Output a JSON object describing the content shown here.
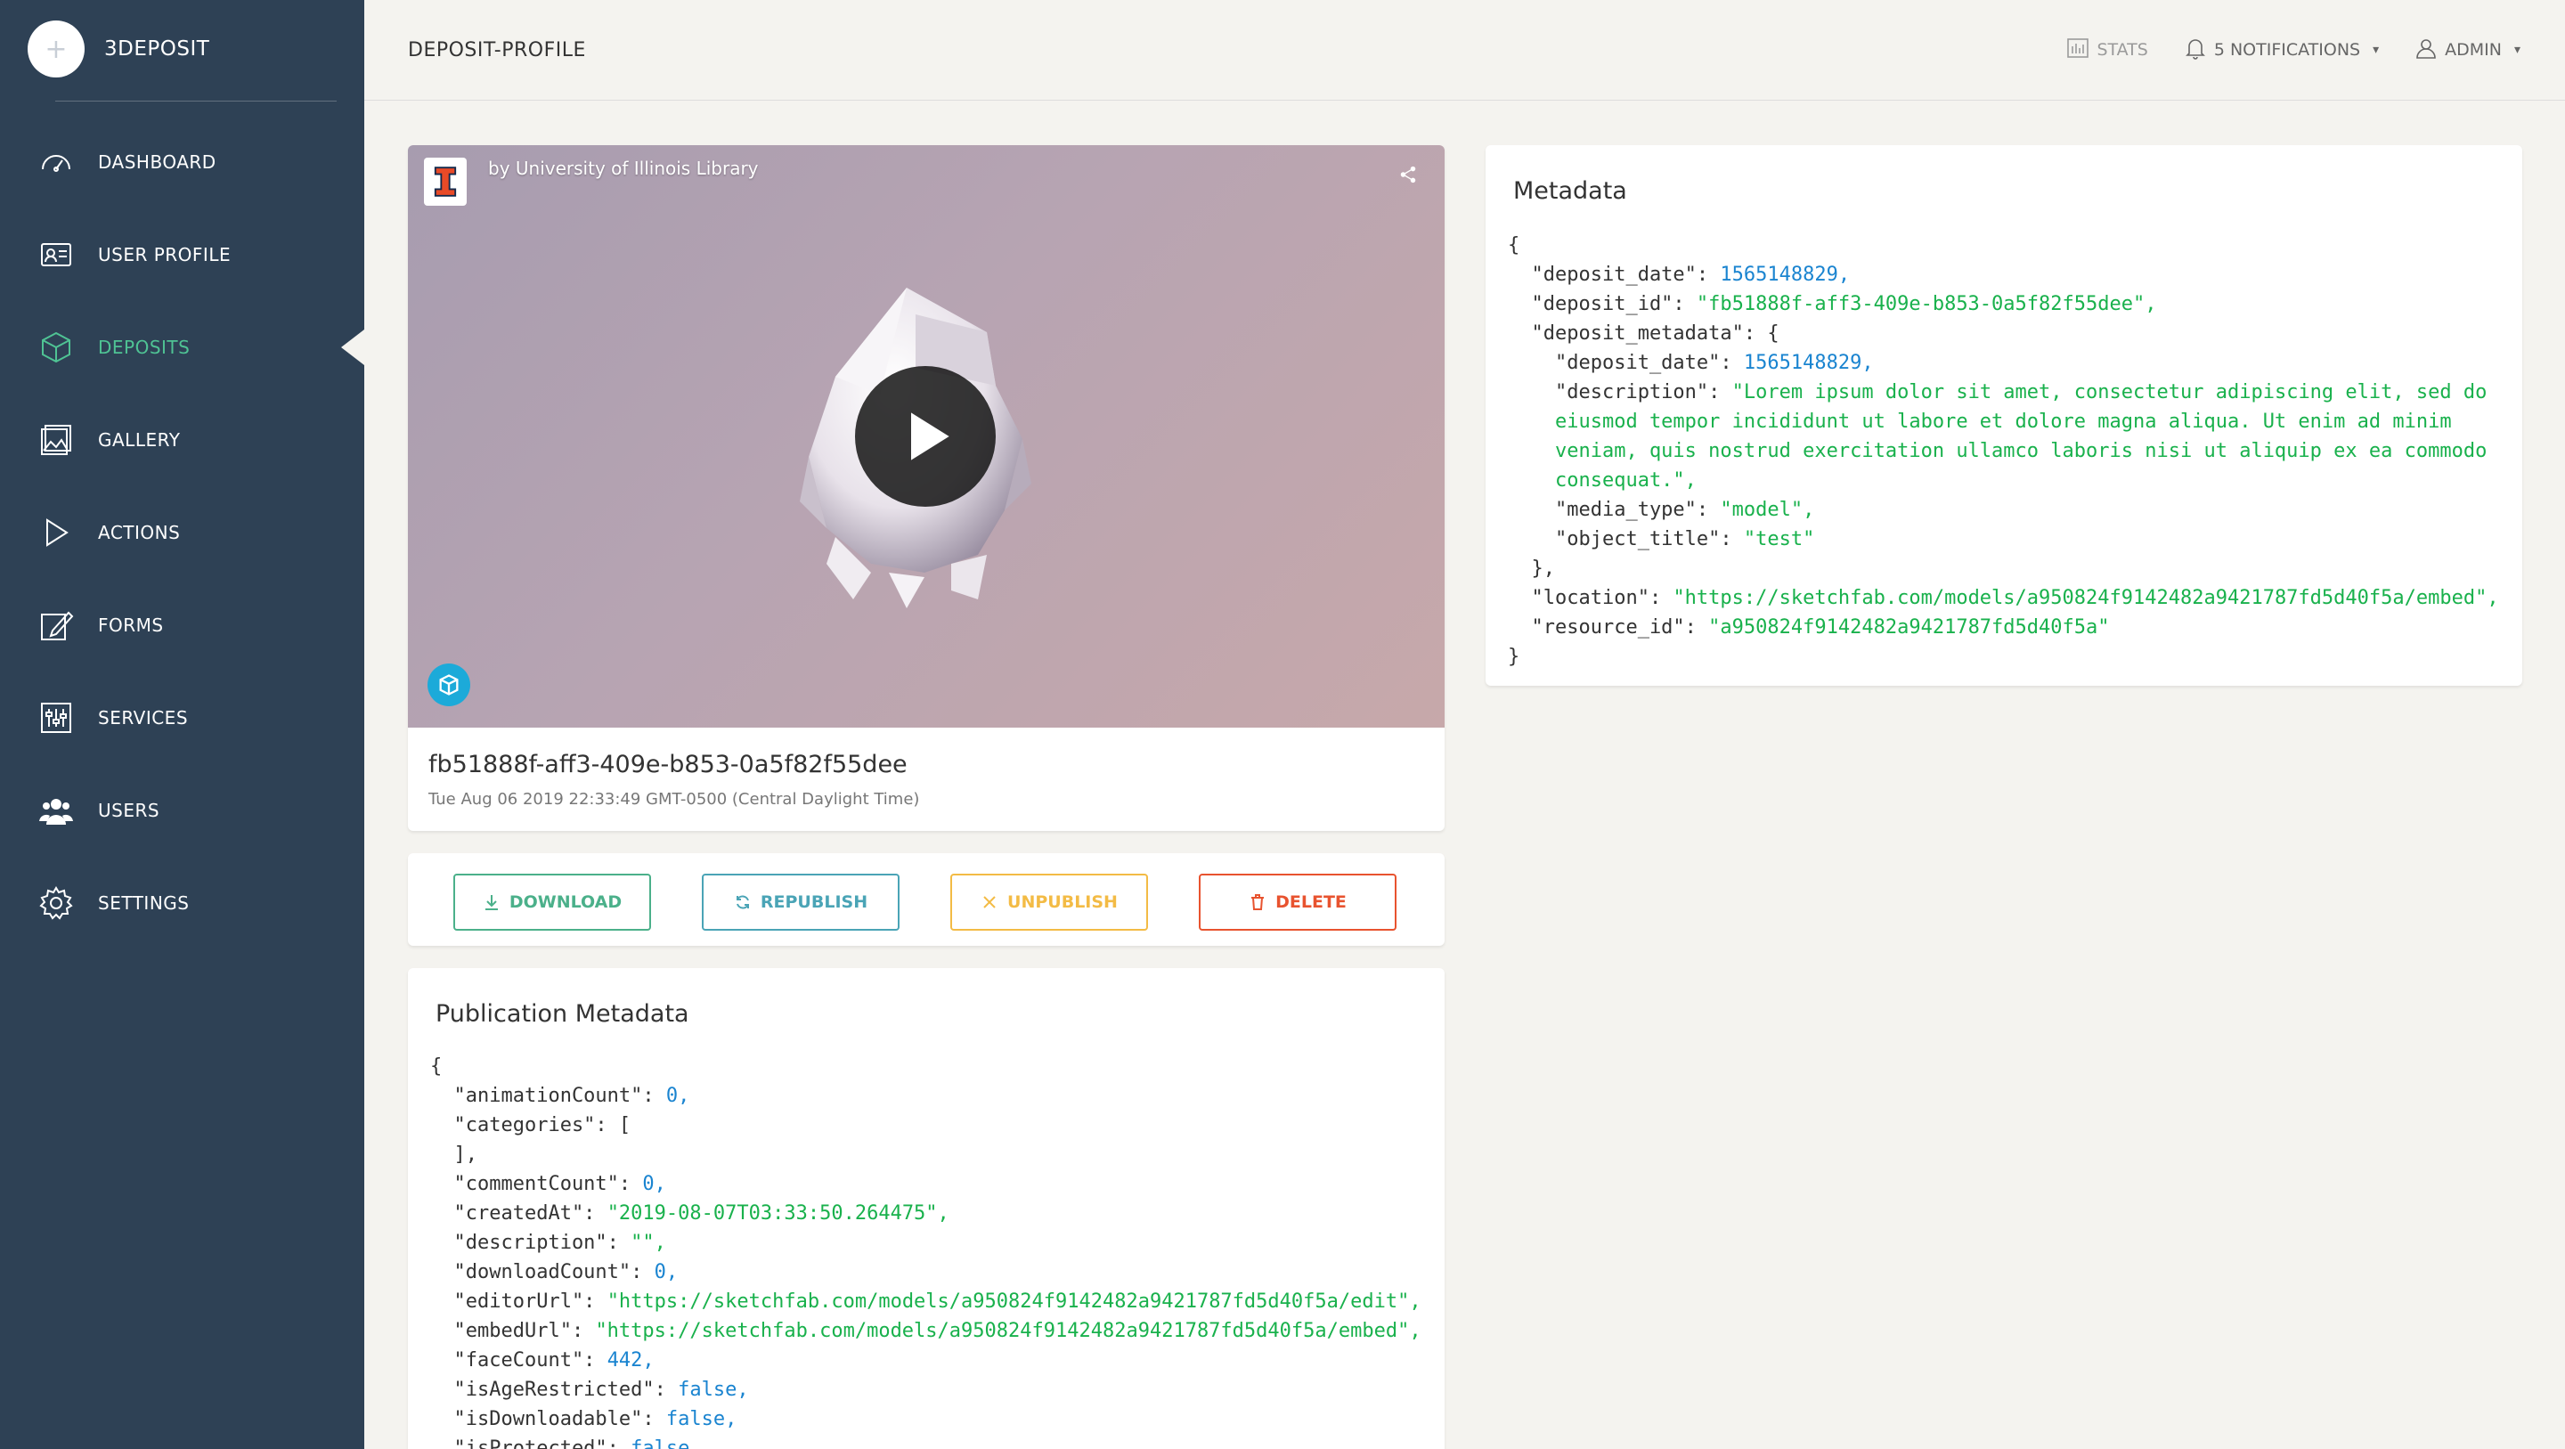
{
  "brand": {
    "name": "3DEPOSIT"
  },
  "sidebar": {
    "items": [
      {
        "label": "DASHBOARD",
        "icon": "dashboard-icon"
      },
      {
        "label": "USER PROFILE",
        "icon": "user-profile-icon"
      },
      {
        "label": "DEPOSITS",
        "icon": "cube-icon",
        "active": true
      },
      {
        "label": "GALLERY",
        "icon": "gallery-icon"
      },
      {
        "label": "ACTIONS",
        "icon": "play-icon"
      },
      {
        "label": "FORMS",
        "icon": "edit-icon"
      },
      {
        "label": "SERVICES",
        "icon": "sliders-icon"
      },
      {
        "label": "USERS",
        "icon": "users-icon"
      },
      {
        "label": "SETTINGS",
        "icon": "gear-icon"
      }
    ]
  },
  "header": {
    "title": "DEPOSIT-PROFILE",
    "stats": "STATS",
    "notifications": "5 NOTIFICATIONS",
    "user": "ADMIN"
  },
  "video": {
    "byline": "by University of Illinois Library",
    "deposit_id": "fb51888f-aff3-409e-b853-0a5f82f55dee",
    "date": "Tue Aug 06 2019 22:33:49 GMT-0500 (Central Daylight Time)"
  },
  "actions": {
    "download": "DOWNLOAD",
    "republish": "REPUBLISH",
    "unpublish": "UNPUBLISH",
    "delete": "DELETE"
  },
  "colors": {
    "sidebar": "#2e4155",
    "accent": "#4fc394",
    "download": "#4bb08a",
    "republish": "#4aa4b6",
    "unpublish": "#f3bb45",
    "delete": "#e8532f",
    "json_number": "#1a84d0",
    "json_string": "#19b14c"
  },
  "metadata": {
    "title": "Metadata",
    "lines": [
      [
        [
          "p",
          "{"
        ]
      ],
      [
        [
          "p",
          "  \"deposit_date\": "
        ],
        [
          "n",
          "1565148829,"
        ]
      ],
      [
        [
          "p",
          "  \"deposit_id\": "
        ],
        [
          "s",
          "\"fb51888f-aff3-409e-b853-0a5f82f55dee\","
        ]
      ],
      [
        [
          "p",
          "  \"deposit_metadata\": {"
        ]
      ],
      [
        [
          "p",
          "    \"deposit_date\": "
        ],
        [
          "n",
          "1565148829,"
        ]
      ],
      [
        [
          "p",
          "    \"description\": "
        ],
        [
          "s",
          "\"Lorem ipsum dolor sit amet, consectetur adipiscing elit, sed do"
        ]
      ],
      [
        [
          "s",
          "    eiusmod tempor incididunt ut labore et dolore magna aliqua. Ut enim ad minim"
        ]
      ],
      [
        [
          "s",
          "    veniam, quis nostrud exercitation ullamco laboris nisi ut aliquip ex ea commodo"
        ]
      ],
      [
        [
          "s",
          "    consequat.\","
        ]
      ],
      [
        [
          "p",
          "    \"media_type\": "
        ],
        [
          "s",
          "\"model\","
        ]
      ],
      [
        [
          "p",
          "    \"object_title\": "
        ],
        [
          "s",
          "\"test\""
        ]
      ],
      [
        [
          "p",
          "  },"
        ]
      ],
      [
        [
          "p",
          "  \"location\": "
        ],
        [
          "s",
          "\"https://sketchfab.com/models/a950824f9142482a9421787fd5d40f5a/embed\","
        ]
      ],
      [
        [
          "p",
          "  \"resource_id\": "
        ],
        [
          "s",
          "\"a950824f9142482a9421787fd5d40f5a\""
        ]
      ],
      [
        [
          "p",
          "}"
        ]
      ]
    ]
  },
  "publication": {
    "title": "Publication Metadata",
    "lines": [
      [
        [
          "p",
          "{"
        ]
      ],
      [
        [
          "p",
          "  \"animationCount\": "
        ],
        [
          "n",
          "0,"
        ]
      ],
      [
        [
          "p",
          "  \"categories\": ["
        ]
      ],
      [
        [
          "p",
          "  ],"
        ]
      ],
      [
        [
          "p",
          "  \"commentCount\": "
        ],
        [
          "n",
          "0,"
        ]
      ],
      [
        [
          "p",
          "  \"createdAt\": "
        ],
        [
          "s",
          "\"2019-08-07T03:33:50.264475\","
        ]
      ],
      [
        [
          "p",
          "  \"description\": "
        ],
        [
          "s",
          "\"\","
        ]
      ],
      [
        [
          "p",
          "  \"downloadCount\": "
        ],
        [
          "n",
          "0,"
        ]
      ],
      [
        [
          "p",
          "  \"editorUrl\": "
        ],
        [
          "s",
          "\"https://sketchfab.com/models/a950824f9142482a9421787fd5d40f5a/edit\","
        ]
      ],
      [
        [
          "p",
          "  \"embedUrl\": "
        ],
        [
          "s",
          "\"https://sketchfab.com/models/a950824f9142482a9421787fd5d40f5a/embed\","
        ]
      ],
      [
        [
          "p",
          "  \"faceCount\": "
        ],
        [
          "n",
          "442,"
        ]
      ],
      [
        [
          "p",
          "  \"isAgeRestricted\": "
        ],
        [
          "n",
          "false,"
        ]
      ],
      [
        [
          "p",
          "  \"isDownloadable\": "
        ],
        [
          "n",
          "false,"
        ]
      ],
      [
        [
          "p",
          "  \"isProtected\": "
        ],
        [
          "n",
          "false,"
        ]
      ]
    ]
  }
}
